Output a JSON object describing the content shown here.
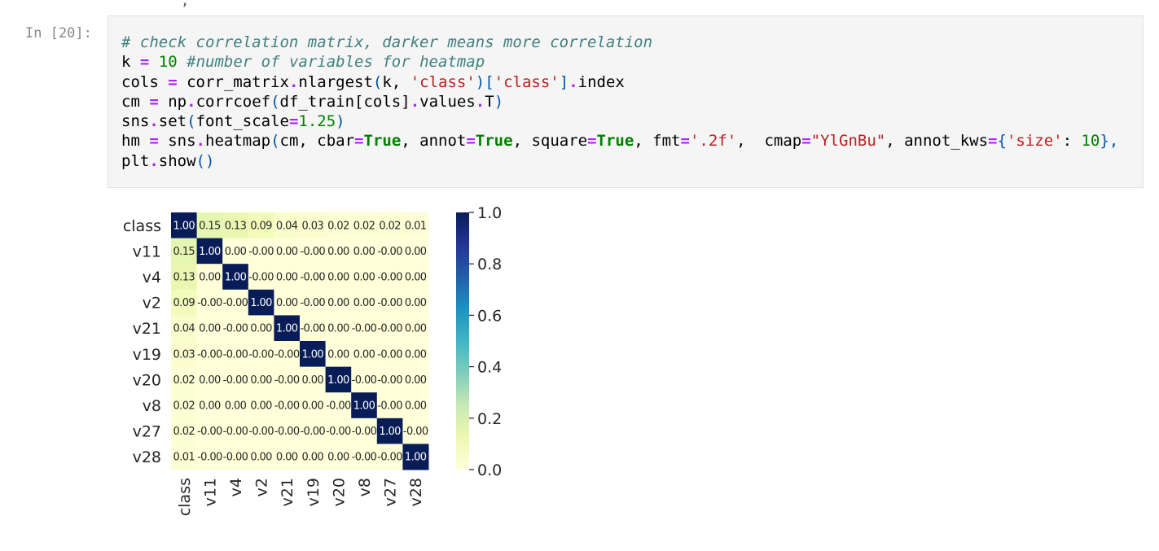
{
  "top_clip": ", ",
  "cell": {
    "prompt": "In [20]:",
    "code_lines": [
      [
        {
          "t": "# check correlation matrix, darker means more correlation",
          "c": "comment"
        }
      ],
      [
        {
          "t": "k ",
          "c": "plain"
        },
        {
          "t": "=",
          "c": "op"
        },
        {
          "t": " ",
          "c": "plain"
        },
        {
          "t": "10",
          "c": "num"
        },
        {
          "t": " ",
          "c": "plain"
        },
        {
          "t": "#number of variables for heatmap",
          "c": "comment"
        }
      ],
      [
        {
          "t": "cols ",
          "c": "plain"
        },
        {
          "t": "=",
          "c": "op"
        },
        {
          "t": " corr_matrix",
          "c": "plain"
        },
        {
          "t": ".",
          "c": "op"
        },
        {
          "t": "nlargest",
          "c": "plain"
        },
        {
          "t": "(",
          "c": "paren"
        },
        {
          "t": "k, ",
          "c": "plain"
        },
        {
          "t": "'class'",
          "c": "str"
        },
        {
          "t": ")[",
          "c": "paren"
        },
        {
          "t": "'class'",
          "c": "str"
        },
        {
          "t": "]",
          "c": "paren"
        },
        {
          "t": ".",
          "c": "op"
        },
        {
          "t": "index",
          "c": "plain"
        }
      ],
      [
        {
          "t": "cm ",
          "c": "plain"
        },
        {
          "t": "=",
          "c": "op"
        },
        {
          "t": " np",
          "c": "plain"
        },
        {
          "t": ".",
          "c": "op"
        },
        {
          "t": "corrcoef",
          "c": "plain"
        },
        {
          "t": "(",
          "c": "paren"
        },
        {
          "t": "df_train[cols]",
          "c": "plain"
        },
        {
          "t": ".",
          "c": "op"
        },
        {
          "t": "values",
          "c": "plain"
        },
        {
          "t": ".",
          "c": "op"
        },
        {
          "t": "T",
          "c": "plain"
        },
        {
          "t": ")",
          "c": "paren"
        }
      ],
      [
        {
          "t": "sns",
          "c": "plain"
        },
        {
          "t": ".",
          "c": "op"
        },
        {
          "t": "set",
          "c": "plain"
        },
        {
          "t": "(",
          "c": "paren"
        },
        {
          "t": "font_scale",
          "c": "plain"
        },
        {
          "t": "=",
          "c": "op"
        },
        {
          "t": "1.25",
          "c": "num"
        },
        {
          "t": ")",
          "c": "paren"
        }
      ],
      [
        {
          "t": "hm ",
          "c": "plain"
        },
        {
          "t": "=",
          "c": "op"
        },
        {
          "t": " sns",
          "c": "plain"
        },
        {
          "t": ".",
          "c": "op"
        },
        {
          "t": "heatmap",
          "c": "plain"
        },
        {
          "t": "(",
          "c": "paren"
        },
        {
          "t": "cm, cbar",
          "c": "plain"
        },
        {
          "t": "=",
          "c": "op"
        },
        {
          "t": "True",
          "c": "kw"
        },
        {
          "t": ", annot",
          "c": "plain"
        },
        {
          "t": "=",
          "c": "op"
        },
        {
          "t": "True",
          "c": "kw"
        },
        {
          "t": ", square",
          "c": "plain"
        },
        {
          "t": "=",
          "c": "op"
        },
        {
          "t": "True",
          "c": "kw"
        },
        {
          "t": ", fmt",
          "c": "plain"
        },
        {
          "t": "=",
          "c": "op"
        },
        {
          "t": "'.2f'",
          "c": "str"
        },
        {
          "t": ",  cmap",
          "c": "plain"
        },
        {
          "t": "=",
          "c": "op"
        },
        {
          "t": "\"YlGnBu\"",
          "c": "str"
        },
        {
          "t": ", annot_kws",
          "c": "plain"
        },
        {
          "t": "=",
          "c": "op"
        },
        {
          "t": "{",
          "c": "paren"
        },
        {
          "t": "'size'",
          "c": "str"
        },
        {
          "t": ": ",
          "c": "plain"
        },
        {
          "t": "10",
          "c": "num"
        },
        {
          "t": "},",
          "c": "paren"
        }
      ],
      [
        {
          "t": "plt",
          "c": "plain"
        },
        {
          "t": ".",
          "c": "op"
        },
        {
          "t": "show",
          "c": "plain"
        },
        {
          "t": "()",
          "c": "paren"
        }
      ]
    ]
  },
  "syntax_colors": {
    "comment": "#408080",
    "op": "#aa22ff",
    "num": "#008000",
    "str": "#ba2121",
    "kw": "#008000",
    "paren": "#0055aa",
    "plain": "#000000"
  },
  "chart_data": {
    "type": "heatmap",
    "title": "",
    "colormap": "YlGnBu",
    "row_labels": [
      "class",
      "v11",
      "v4",
      "v2",
      "v21",
      "v19",
      "v20",
      "v8",
      "v27",
      "v28"
    ],
    "col_labels": [
      "class",
      "v11",
      "v4",
      "v2",
      "v21",
      "v19",
      "v20",
      "v8",
      "v27",
      "v28"
    ],
    "values": [
      [
        1.0,
        0.15,
        0.13,
        0.09,
        0.04,
        0.03,
        0.02,
        0.02,
        0.02,
        0.01
      ],
      [
        0.15,
        1.0,
        0.0,
        -0.0,
        0.0,
        -0.0,
        0.0,
        0.0,
        -0.0,
        0.0
      ],
      [
        0.13,
        0.0,
        1.0,
        -0.0,
        0.0,
        -0.0,
        0.0,
        0.0,
        -0.0,
        0.0
      ],
      [
        0.09,
        -0.0,
        -0.0,
        1.0,
        0.0,
        -0.0,
        0.0,
        0.0,
        -0.0,
        0.0
      ],
      [
        0.04,
        0.0,
        -0.0,
        0.0,
        1.0,
        -0.0,
        0.0,
        -0.0,
        -0.0,
        0.0
      ],
      [
        0.03,
        -0.0,
        -0.0,
        -0.0,
        -0.0,
        1.0,
        0.0,
        0.0,
        -0.0,
        0.0
      ],
      [
        0.02,
        0.0,
        -0.0,
        0.0,
        -0.0,
        0.0,
        1.0,
        -0.0,
        -0.0,
        0.0
      ],
      [
        0.02,
        0.0,
        0.0,
        0.0,
        -0.0,
        0.0,
        -0.0,
        1.0,
        -0.0,
        0.0
      ],
      [
        0.02,
        -0.0,
        -0.0,
        -0.0,
        -0.0,
        -0.0,
        -0.0,
        -0.0,
        1.0,
        -0.0
      ],
      [
        0.01,
        -0.0,
        -0.0,
        0.0,
        0.0,
        0.0,
        0.0,
        -0.0,
        -0.0,
        1.0
      ]
    ],
    "annotations": [
      [
        "1.00",
        "0.15",
        "0.13",
        "0.09",
        "0.04",
        "0.03",
        "0.02",
        "0.02",
        "0.02",
        "0.01"
      ],
      [
        "0.15",
        "1.00",
        "0.00",
        "-0.00",
        "0.00",
        "-0.00",
        "0.00",
        "0.00",
        "-0.00",
        "0.00"
      ],
      [
        "0.13",
        "0.00",
        "1.00",
        "-0.00",
        "0.00",
        "-0.00",
        "0.00",
        "0.00",
        "-0.00",
        "0.00"
      ],
      [
        "0.09",
        "-0.00",
        "-0.00",
        "1.00",
        "0.00",
        "-0.00",
        "0.00",
        "0.00",
        "-0.00",
        "0.00"
      ],
      [
        "0.04",
        "0.00",
        "-0.00",
        "0.00",
        "1.00",
        "-0.00",
        "0.00",
        "-0.00",
        "-0.00",
        "0.00"
      ],
      [
        "0.03",
        "-0.00",
        "-0.00",
        "-0.00",
        "-0.00",
        "1.00",
        "0.00",
        "0.00",
        "-0.00",
        "0.00"
      ],
      [
        "0.02",
        "0.00",
        "-0.00",
        "0.00",
        "-0.00",
        "0.00",
        "1.00",
        "-0.00",
        "-0.00",
        "0.00"
      ],
      [
        "0.02",
        "0.00",
        "0.00",
        "0.00",
        "-0.00",
        "0.00",
        "-0.00",
        "1.00",
        "-0.00",
        "0.00"
      ],
      [
        "0.02",
        "-0.00",
        "-0.00",
        "-0.00",
        "-0.00",
        "-0.00",
        "-0.00",
        "-0.00",
        "1.00",
        "-0.00"
      ],
      [
        "0.01",
        "-0.00",
        "-0.00",
        "0.00",
        "0.00",
        "0.00",
        "0.00",
        "-0.00",
        "-0.00",
        "1.00"
      ]
    ],
    "colorbar": {
      "range": [
        0,
        1.0
      ],
      "ticks": [
        0.0,
        0.2,
        0.4,
        0.6,
        0.8,
        1.0
      ],
      "tick_labels": [
        "0.0",
        "0.2",
        "0.4",
        "0.6",
        "0.8",
        "1.0"
      ]
    },
    "colorscale_stops": [
      "#ffffd9",
      "#edf8b1",
      "#c7e9b4",
      "#7fcdbb",
      "#41b6c4",
      "#1d91c0",
      "#225ea8",
      "#253494",
      "#081d58"
    ],
    "annotation_colors": {
      "dark_text": "#262626",
      "light_text": "#ffffff"
    }
  }
}
